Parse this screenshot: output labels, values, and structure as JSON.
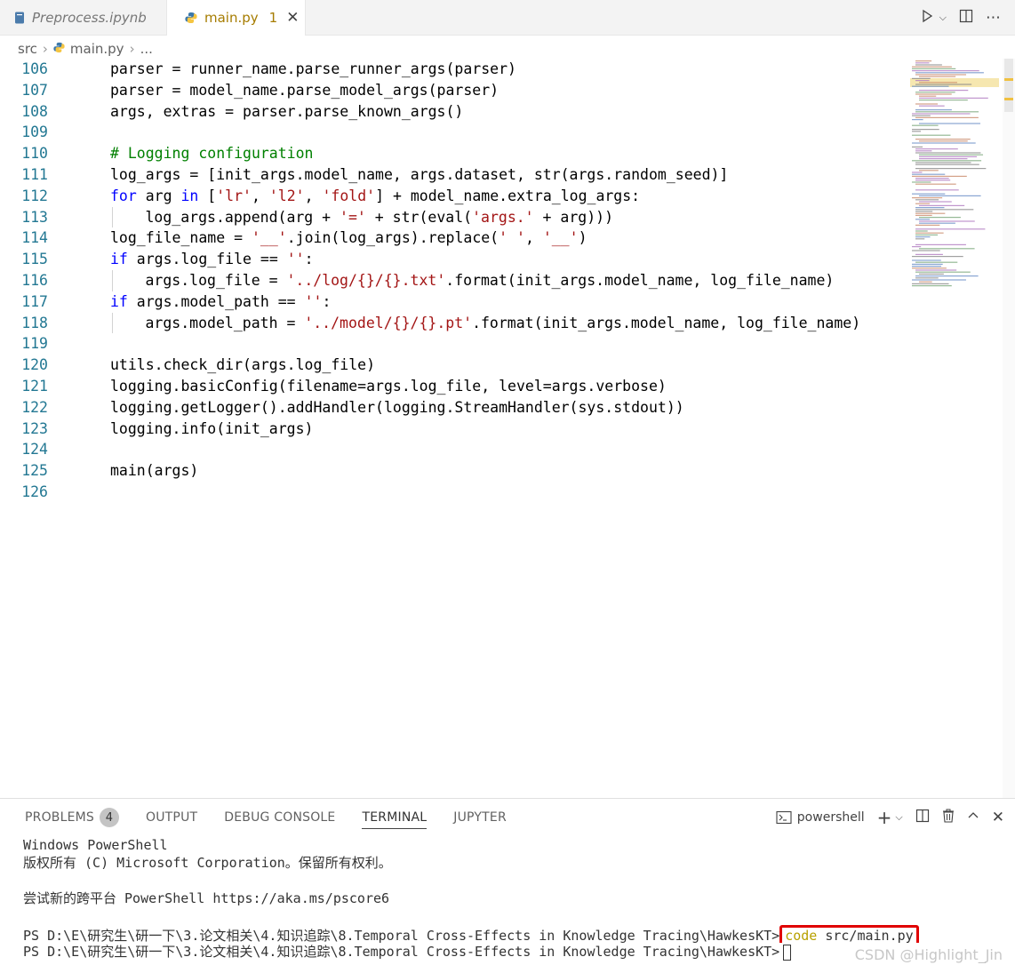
{
  "tabs": [
    {
      "label": "Preprocess.ipynb",
      "active": false
    },
    {
      "label": "main.py",
      "active": true,
      "problems": "1"
    }
  ],
  "breadcrumb": [
    "src",
    "main.py",
    "..."
  ],
  "editor": {
    "lines": [
      {
        "num": "106",
        "indent": 1,
        "tokens": [
          {
            "t": "parser = runner_name.parse_runner_args(parser)",
            "c": ""
          }
        ]
      },
      {
        "num": "107",
        "indent": 1,
        "tokens": [
          {
            "t": "parser = model_name.parse_model_args(parser)",
            "c": ""
          }
        ]
      },
      {
        "num": "108",
        "indent": 1,
        "tokens": [
          {
            "t": "args, extras = parser.parse_known_args()",
            "c": ""
          }
        ]
      },
      {
        "num": "109",
        "indent": 0,
        "tokens": []
      },
      {
        "num": "110",
        "indent": 1,
        "tokens": [
          {
            "t": "# Logging configuration",
            "c": "cm"
          }
        ]
      },
      {
        "num": "111",
        "indent": 1,
        "tokens": [
          {
            "t": "log_args = [init_args.model_name, args.dataset, str(args.random_seed)]",
            "c": ""
          }
        ]
      },
      {
        "num": "112",
        "indent": 1,
        "tokens": [
          {
            "t": "for",
            "c": "kw"
          },
          {
            "t": " arg ",
            "c": ""
          },
          {
            "t": "in",
            "c": "kw"
          },
          {
            "t": " [",
            "c": ""
          },
          {
            "t": "'lr'",
            "c": "str"
          },
          {
            "t": ", ",
            "c": ""
          },
          {
            "t": "'l2'",
            "c": "str"
          },
          {
            "t": ", ",
            "c": ""
          },
          {
            "t": "'fold'",
            "c": "str"
          },
          {
            "t": "] + model_name.extra_log_args:",
            "c": ""
          }
        ]
      },
      {
        "num": "113",
        "indent": 2,
        "tokens": [
          {
            "t": "log_args.append(arg + ",
            "c": ""
          },
          {
            "t": "'='",
            "c": "str"
          },
          {
            "t": " + str(eval(",
            "c": ""
          },
          {
            "t": "'args.'",
            "c": "str"
          },
          {
            "t": " + arg)))",
            "c": ""
          }
        ]
      },
      {
        "num": "114",
        "indent": 1,
        "tokens": [
          {
            "t": "log_file_name = ",
            "c": ""
          },
          {
            "t": "'__'",
            "c": "str"
          },
          {
            "t": ".join(log_args).replace(",
            "c": ""
          },
          {
            "t": "' '",
            "c": "str"
          },
          {
            "t": ", ",
            "c": ""
          },
          {
            "t": "'__'",
            "c": "str"
          },
          {
            "t": ")",
            "c": ""
          }
        ]
      },
      {
        "num": "115",
        "indent": 1,
        "tokens": [
          {
            "t": "if",
            "c": "kw"
          },
          {
            "t": " args.log_file == ",
            "c": ""
          },
          {
            "t": "''",
            "c": "str"
          },
          {
            "t": ":",
            "c": ""
          }
        ]
      },
      {
        "num": "116",
        "indent": 2,
        "tokens": [
          {
            "t": "args.log_file = ",
            "c": ""
          },
          {
            "t": "'../log/{}/{}.txt'",
            "c": "str"
          },
          {
            "t": ".format(init_args.model_name, log_file_name)",
            "c": ""
          }
        ]
      },
      {
        "num": "117",
        "indent": 1,
        "tokens": [
          {
            "t": "if",
            "c": "kw"
          },
          {
            "t": " args.model_path == ",
            "c": ""
          },
          {
            "t": "''",
            "c": "str"
          },
          {
            "t": ":",
            "c": ""
          }
        ]
      },
      {
        "num": "118",
        "indent": 2,
        "tokens": [
          {
            "t": "args.model_path = ",
            "c": ""
          },
          {
            "t": "'../model/{}/{}.pt'",
            "c": "str"
          },
          {
            "t": ".format(init_args.model_name, log_file_name)",
            "c": ""
          }
        ]
      },
      {
        "num": "119",
        "indent": 0,
        "tokens": []
      },
      {
        "num": "120",
        "indent": 1,
        "tokens": [
          {
            "t": "utils.check_dir(args.log_file)",
            "c": ""
          }
        ]
      },
      {
        "num": "121",
        "indent": 1,
        "tokens": [
          {
            "t": "logging.basicConfig(filename=args.log_file, level=args.verbose)",
            "c": ""
          }
        ]
      },
      {
        "num": "122",
        "indent": 1,
        "tokens": [
          {
            "t": "logging.getLogger().addHandler(logging.StreamHandler(sys.stdout))",
            "c": ""
          }
        ]
      },
      {
        "num": "123",
        "indent": 1,
        "tokens": [
          {
            "t": "logging.info(init_args)",
            "c": ""
          }
        ]
      },
      {
        "num": "124",
        "indent": 0,
        "tokens": []
      },
      {
        "num": "125",
        "indent": 1,
        "tokens": [
          {
            "t": "main(args)",
            "c": ""
          }
        ]
      },
      {
        "num": "126",
        "indent": 0,
        "tokens": []
      }
    ]
  },
  "panel": {
    "tabs": [
      {
        "label": "PROBLEMS",
        "badge": "4",
        "active": false
      },
      {
        "label": "OUTPUT",
        "active": false
      },
      {
        "label": "DEBUG CONSOLE",
        "active": false
      },
      {
        "label": "TERMINAL",
        "active": true
      },
      {
        "label": "JUPYTER",
        "active": false
      }
    ],
    "shell": "powershell"
  },
  "terminal": {
    "line1": "Windows PowerShell",
    "line2": "版权所有 (C) Microsoft Corporation。保留所有权利。",
    "line3": "尝试新的跨平台 PowerShell https://aka.ms/pscore6",
    "prompt": "PS D:\\E\\研究生\\研一下\\3.论文相关\\4.知识追踪\\8.Temporal Cross-Effects in Knowledge Tracing\\HawkesKT>",
    "cmd_keyword": "code",
    "cmd_arg": " src/main.py"
  },
  "watermark": "CSDN @Highlight_Jin",
  "colors": {
    "keyword": "#0000ff",
    "string": "#a31515",
    "comment": "#008000",
    "line_number": "#237893",
    "highlight_box": "#e00000"
  }
}
